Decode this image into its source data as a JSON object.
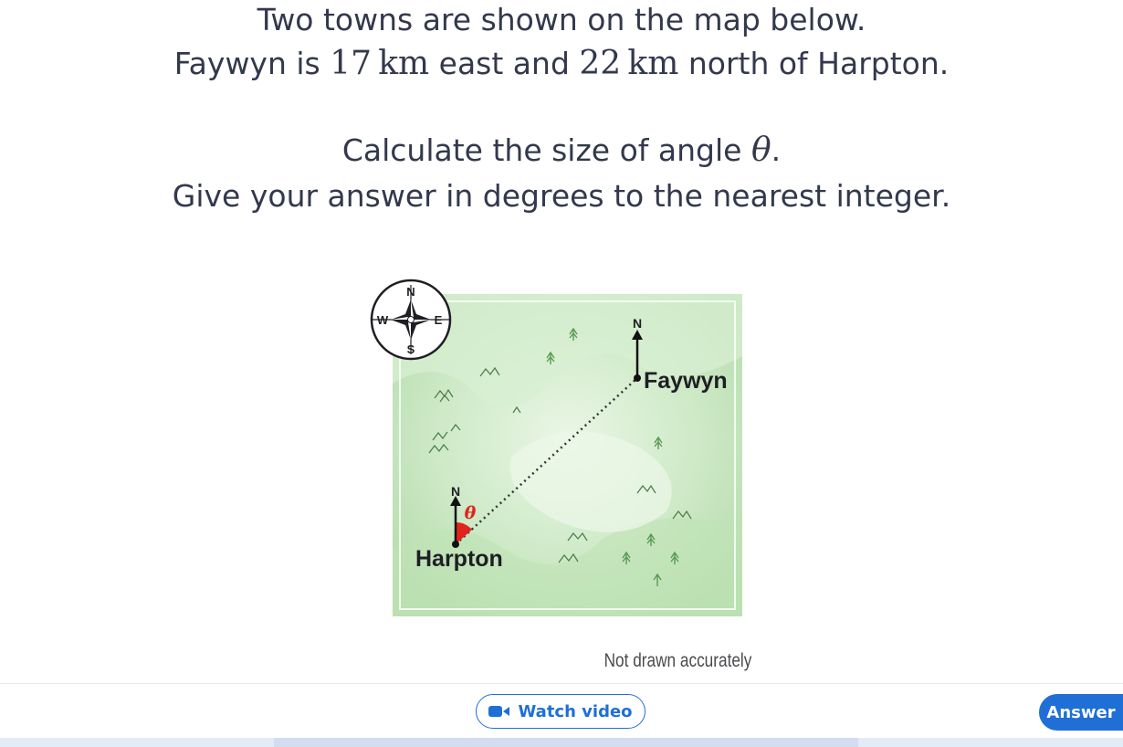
{
  "question": {
    "line1": "Two towns are shown on the map below.",
    "line2": {
      "town_a": "Faywyn",
      "part1": " is ",
      "east_distance": "17 km",
      "part2": " east and ",
      "north_distance": "22 km",
      "part3": " north of ",
      "town_b": "Harpton",
      "end": "."
    },
    "line3": {
      "before": "Calculate the size of angle ",
      "symbol": "θ",
      "after": "."
    },
    "line4": "Give your answer in degrees to the nearest integer."
  },
  "figure": {
    "compass": {
      "n": "N",
      "e": "E",
      "s": "S",
      "w": "W"
    },
    "north_label_faywyn": "N",
    "north_label_harpton": "N",
    "town_faywyn": "Faywyn",
    "town_harpton": "Harpton",
    "angle_label": "θ",
    "note": "Not drawn accurately"
  },
  "buttons": {
    "watch_video": "Watch video",
    "answer": "Answer"
  },
  "colors": {
    "accent": "#1f6fd6",
    "angle": "#e0241c",
    "map": "#c8e6c0"
  }
}
